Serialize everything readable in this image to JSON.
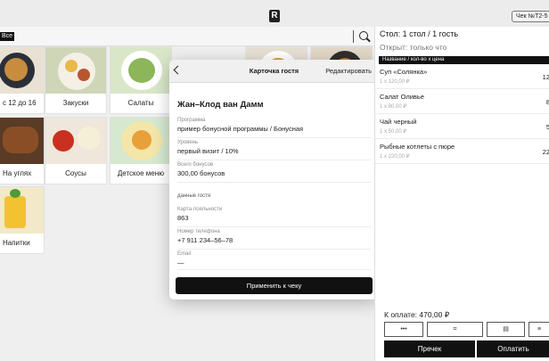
{
  "header": {
    "check_number": "Чек №Т2-5"
  },
  "categories_bar": {
    "active_chip": "Все"
  },
  "menu_tiles": [
    {
      "label": "с 12 до 16"
    },
    {
      "label": "Закуски"
    },
    {
      "label": "Салаты"
    },
    {
      "label": ""
    },
    {
      "label": "На углях"
    },
    {
      "label": "Соусы"
    },
    {
      "label": "Детское меню"
    },
    {
      "label": "Напитки"
    }
  ],
  "guest_card": {
    "title": "Карточка гостя",
    "edit_label": "Редактировать",
    "guest_name": "Жан–Клод ван Дамм",
    "program_label": "Программа",
    "program_value": "пример бонусной программы / Бонусная",
    "level_label": "Уровень",
    "level_value": "первый визит / 10%",
    "bonuses_label": "Всего бонусов",
    "bonuses_value": "300,00 бонусов",
    "section_label": "данные гостя",
    "loyalty_label": "Карта лояльности",
    "loyalty_value": "863",
    "phone_label": "Номер телефона",
    "phone_value": "+7 911 234–56–78",
    "email_label": "Email",
    "email_value": "—",
    "apply_label": "Применить к чеку"
  },
  "order": {
    "table_info": "Стол: 1 стол / 1 гость",
    "opened_info": "Открыт: только что",
    "column_header": "Название / кол-во x цена",
    "items": [
      {
        "name": "Суп «Солянка»",
        "qty_price": "1 x 120,00 ₽",
        "total": "12"
      },
      {
        "name": "Салат Оливье",
        "qty_price": "1 x 80,00 ₽",
        "total": "8"
      },
      {
        "name": "Чай черный",
        "qty_price": "1 x 50,00 ₽",
        "total": "5"
      },
      {
        "name": "Рыбные котлеты с пюре",
        "qty_price": "1 x 220,00 ₽",
        "total": "22"
      }
    ],
    "total_label": "К оплате: 470,00 ₽",
    "tools": [
      "•••",
      "⌗",
      "▤",
      "≡"
    ],
    "precheck_label": "Пречек",
    "pay_label": "Оплатить"
  }
}
